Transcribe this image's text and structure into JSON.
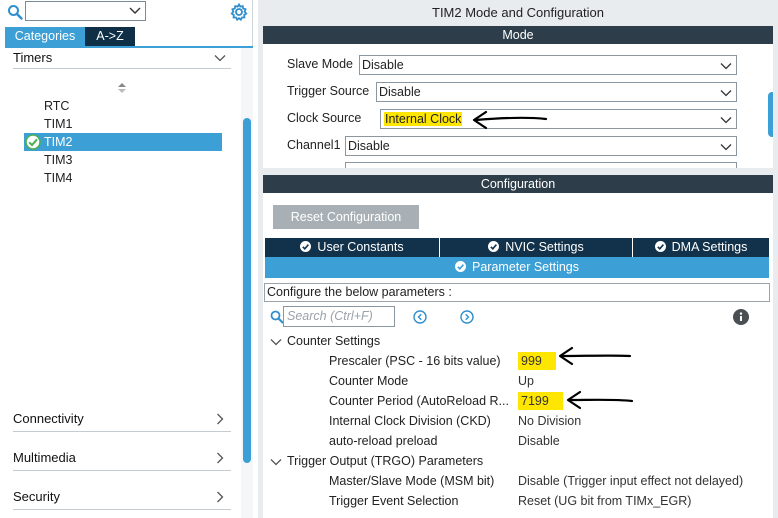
{
  "left": {
    "tabs": {
      "categories": "Categories",
      "az": "A->Z"
    },
    "categories": [
      {
        "label": "Timers",
        "expanded": true
      },
      {
        "label": "Connectivity",
        "expanded": false
      },
      {
        "label": "Multimedia",
        "expanded": false
      },
      {
        "label": "Security",
        "expanded": false
      }
    ],
    "peripherals": [
      "RTC",
      "TIM1",
      "TIM2",
      "TIM3",
      "TIM4"
    ],
    "selected_peripheral": "TIM2"
  },
  "right": {
    "title": "TIM2 Mode and Configuration",
    "mode": {
      "section_title": "Mode",
      "rows": [
        {
          "label": "Slave Mode",
          "value": "Disable"
        },
        {
          "label": "Trigger Source",
          "value": "Disable"
        },
        {
          "label": "Clock Source",
          "value": "Internal Clock"
        },
        {
          "label": "Channel1",
          "value": "Disable"
        }
      ]
    },
    "configuration": {
      "section_title": "Configuration",
      "reset_button": "Reset Configuration",
      "tabs": [
        "User Constants",
        "NVIC Settings",
        "DMA Settings"
      ],
      "active_tab": "Parameter Settings",
      "hint": "Configure the below parameters :",
      "search_placeholder": "Search (Ctrl+F)",
      "groups": [
        {
          "name": "Counter Settings",
          "params": [
            {
              "name": "Prescaler (PSC - 16 bits value)",
              "value": "999"
            },
            {
              "name": "Counter Mode",
              "value": "Up"
            },
            {
              "name": "Counter Period (AutoReload R...",
              "value": "7199"
            },
            {
              "name": "Internal Clock Division (CKD)",
              "value": "No Division"
            },
            {
              "name": "auto-reload preload",
              "value": "Disable"
            }
          ]
        },
        {
          "name": "Trigger Output (TRGO) Parameters",
          "params": [
            {
              "name": "Master/Slave Mode (MSM bit)",
              "value": "Disable (Trigger input effect not delayed)"
            },
            {
              "name": "Trigger Event Selection",
              "value": "Reset (UG bit from TIMx_EGR)"
            }
          ]
        }
      ]
    }
  },
  "colors": {
    "accent": "#3c9fd6",
    "dark_bar": "#2d3e4a",
    "tab_dark": "#12324b",
    "highlight": "#ffe600",
    "check_green": "#4caf50"
  },
  "icons": [
    "search-icon",
    "gear-icon",
    "chevron-down-icon",
    "chevron-right-icon",
    "sort-icon",
    "check-circle-icon",
    "info-icon",
    "arrow-left-circle-icon",
    "arrow-right-circle-icon"
  ]
}
